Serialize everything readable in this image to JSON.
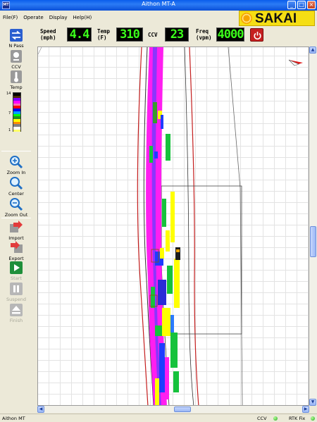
{
  "window": {
    "title": "Aithon MT-A",
    "icon_label": "MT"
  },
  "menu": [
    "File(F)",
    "Operate",
    "Display",
    "Help(H)"
  ],
  "brand": {
    "name": "SAKAI",
    "color": "#F5DE14"
  },
  "readouts": {
    "speed": {
      "label_line1": "Speed",
      "label_line2": "(mph)",
      "value": "4.4"
    },
    "temp": {
      "label_line1": "Temp",
      "label_line2": "(F)",
      "value": "310"
    },
    "ccv": {
      "label": "CCV",
      "value": "23"
    },
    "freq": {
      "label_line1": "Freq",
      "label_line2": "(vpm)",
      "value": "4000"
    }
  },
  "sidebar": {
    "n_pass": "N Pass",
    "ccv": "CCV",
    "temp": "Temp",
    "legend_max": "14",
    "legend_mid": "7",
    "legend_min": "1",
    "zoom_in": "Zoom In",
    "center": "Center",
    "zoom_out": "Zoom Out",
    "import": "Import",
    "export": "Export",
    "start": "Start",
    "suspend": "Suspend",
    "finish": "Finish"
  },
  "legend_colors": [
    "#000000",
    "#4b2a00",
    "#7f00ff",
    "#ff00ff",
    "#ff69b4",
    "#ff0000",
    "#0000ff",
    "#00a0ff",
    "#00ff00",
    "#228B22",
    "#ffff00",
    "#ff8c00",
    "#808080",
    "#ffffff",
    "#ffff66"
  ],
  "statusbar": {
    "app": "Aithon MT",
    "ccv": "CCV",
    "rtk": "RTK Fix"
  }
}
